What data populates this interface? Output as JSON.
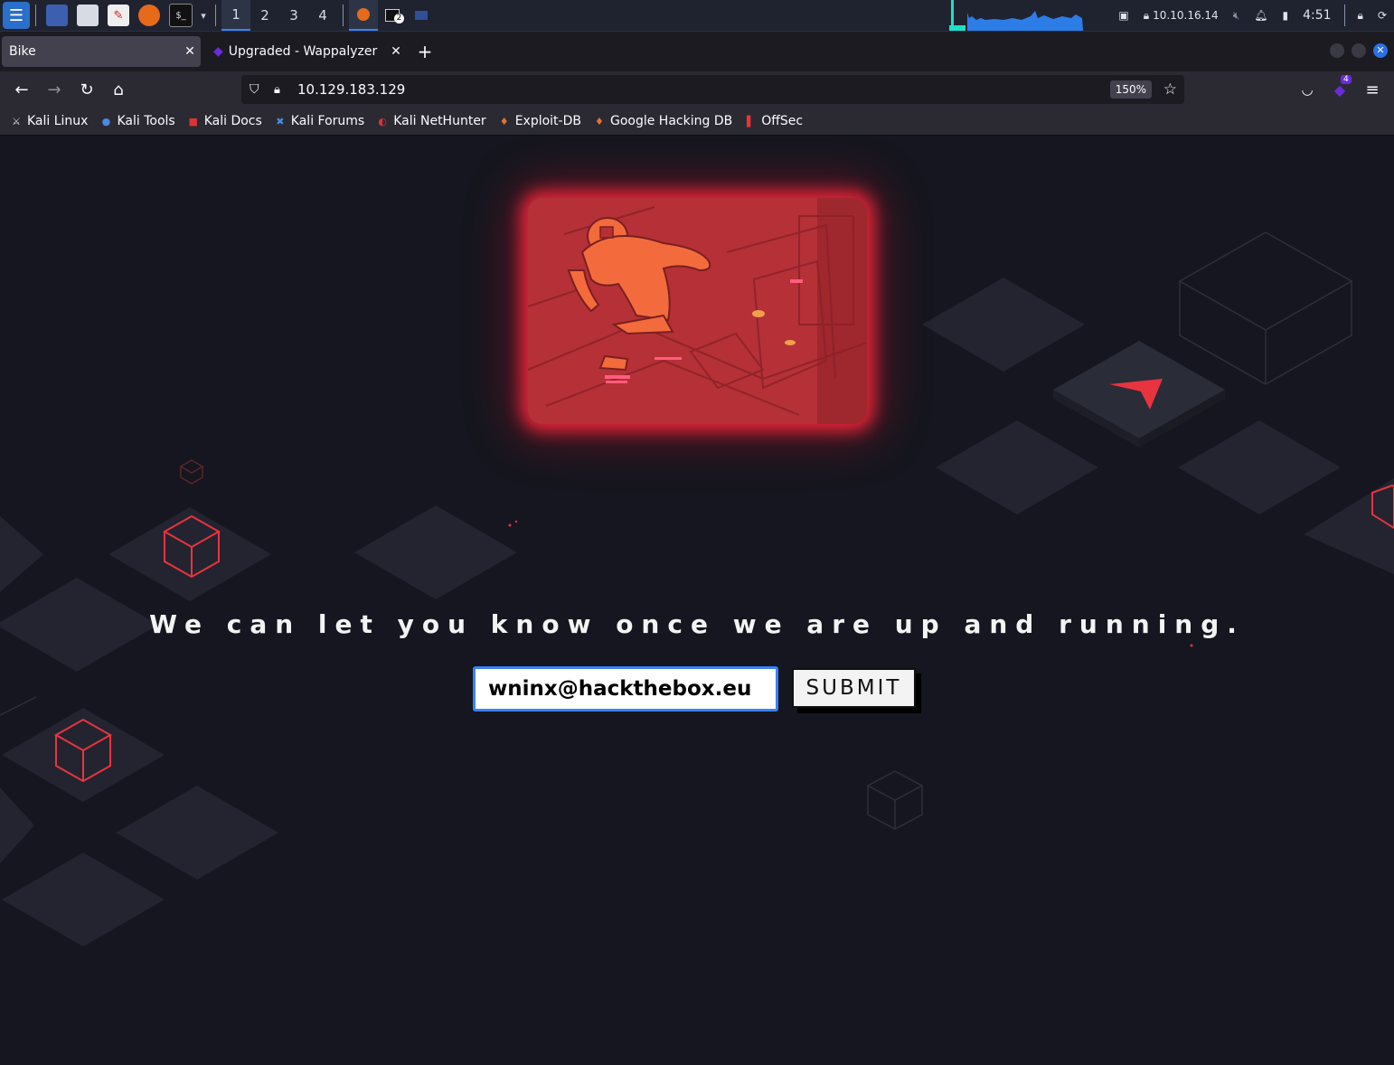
{
  "taskbar": {
    "workspaces": [
      "1",
      "2",
      "3",
      "4"
    ],
    "active_workspace": "1",
    "terminal_badge": "2",
    "ip_address": "10.10.16.14",
    "clock": "4:51"
  },
  "tabs": [
    {
      "label": "Bike",
      "active": true
    },
    {
      "label": "Upgraded - Wappalyzer",
      "active": false
    }
  ],
  "navbar": {
    "url": "10.129.183.129",
    "zoom": "150%",
    "extension_badge": "4"
  },
  "bookmarks": [
    "Kali Linux",
    "Kali Tools",
    "Kali Docs",
    "Kali Forums",
    "Kali NetHunter",
    "Exploit-DB",
    "Google Hacking DB",
    "OffSec"
  ],
  "page": {
    "headline": "We can let you know once we are up and running.",
    "email_value": "wninx@hackthebox.eu",
    "submit_label": "SUBMIT"
  },
  "colors": {
    "accent_red": "#e8343f",
    "page_background": "#15161f",
    "focus_blue": "#3b82f6"
  }
}
